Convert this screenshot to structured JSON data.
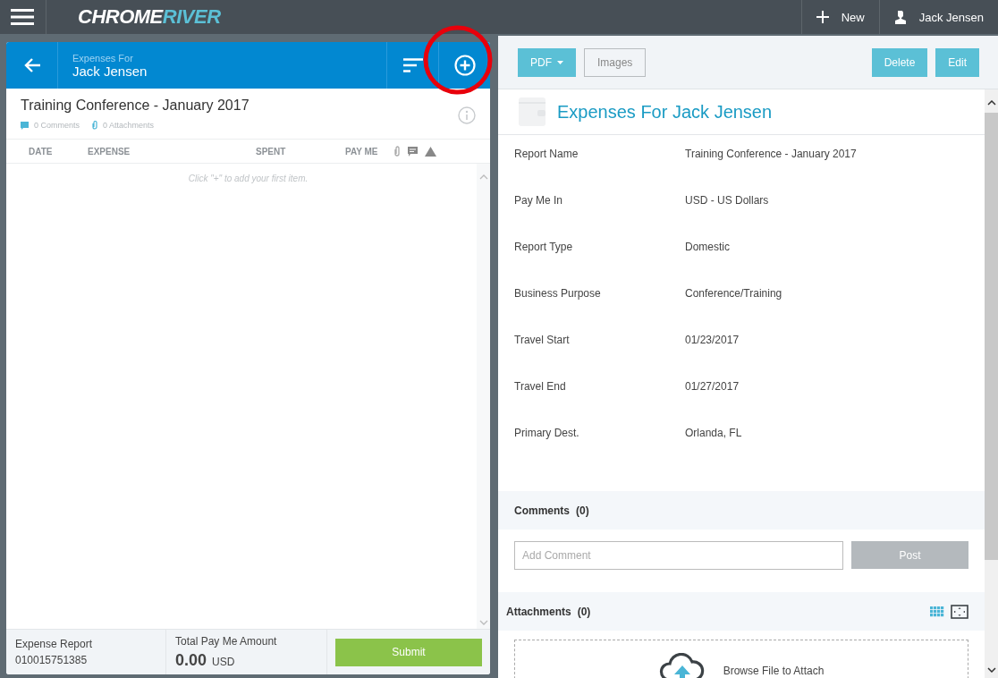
{
  "top_bar": {
    "logo": {
      "first": "CHROME",
      "second": "RIVER"
    },
    "new_label": "New",
    "user": "Jack Jensen"
  },
  "report_panel": {
    "header": {
      "subtitle": "Expenses For",
      "name": "Jack Jensen"
    },
    "add_highlighted": true,
    "title": "Training Conference - January 2017",
    "comments": "0 Comments",
    "attachments": "0 Attachments",
    "columns": [
      {
        "label": "DATE",
        "kind": "text"
      },
      {
        "label": "EXPENSE",
        "kind": "text"
      },
      {
        "label": "SPENT",
        "kind": "text"
      },
      {
        "label": "PAY ME",
        "kind": "text"
      }
    ],
    "empty_message": "Click \"+\" to add your first item.",
    "footer": {
      "report_label": "Expense Report",
      "report_number": "010015751385",
      "total_label": "Total Pay Me Amount",
      "total": "0.00",
      "currency": "USD",
      "submit": "Submit"
    }
  },
  "detail_panel": {
    "toolbar": [
      {
        "label": "PDF",
        "kind": "dropdown"
      },
      {
        "label": "Images",
        "kind": "outline"
      },
      {
        "label": "Delete",
        "kind": "solid"
      },
      {
        "label": "Edit",
        "kind": "solid"
      }
    ],
    "title": "Expenses For Jack Jensen",
    "fields": [
      {
        "label": "Report Name",
        "value": "Training Conference - January 2017"
      },
      {
        "label": "Pay Me In",
        "value": "USD - US Dollars"
      },
      {
        "label": "Report Type",
        "value": "Domestic"
      },
      {
        "label": "Business Purpose",
        "value": "Conference/Training"
      },
      {
        "label": "Travel Start",
        "value": "01/23/2017"
      },
      {
        "label": "Travel End",
        "value": "01/27/2017"
      },
      {
        "label": "Primary Dest.",
        "value": "Orlanda, FL"
      }
    ],
    "comments": {
      "title": "Comments",
      "count": "(0)",
      "placeholder": "Add Comment",
      "post": "Post",
      "post_disabled": true
    },
    "attachments": {
      "title": "Attachments",
      "count": "(0)",
      "browse": "Browse File to Attach"
    }
  }
}
